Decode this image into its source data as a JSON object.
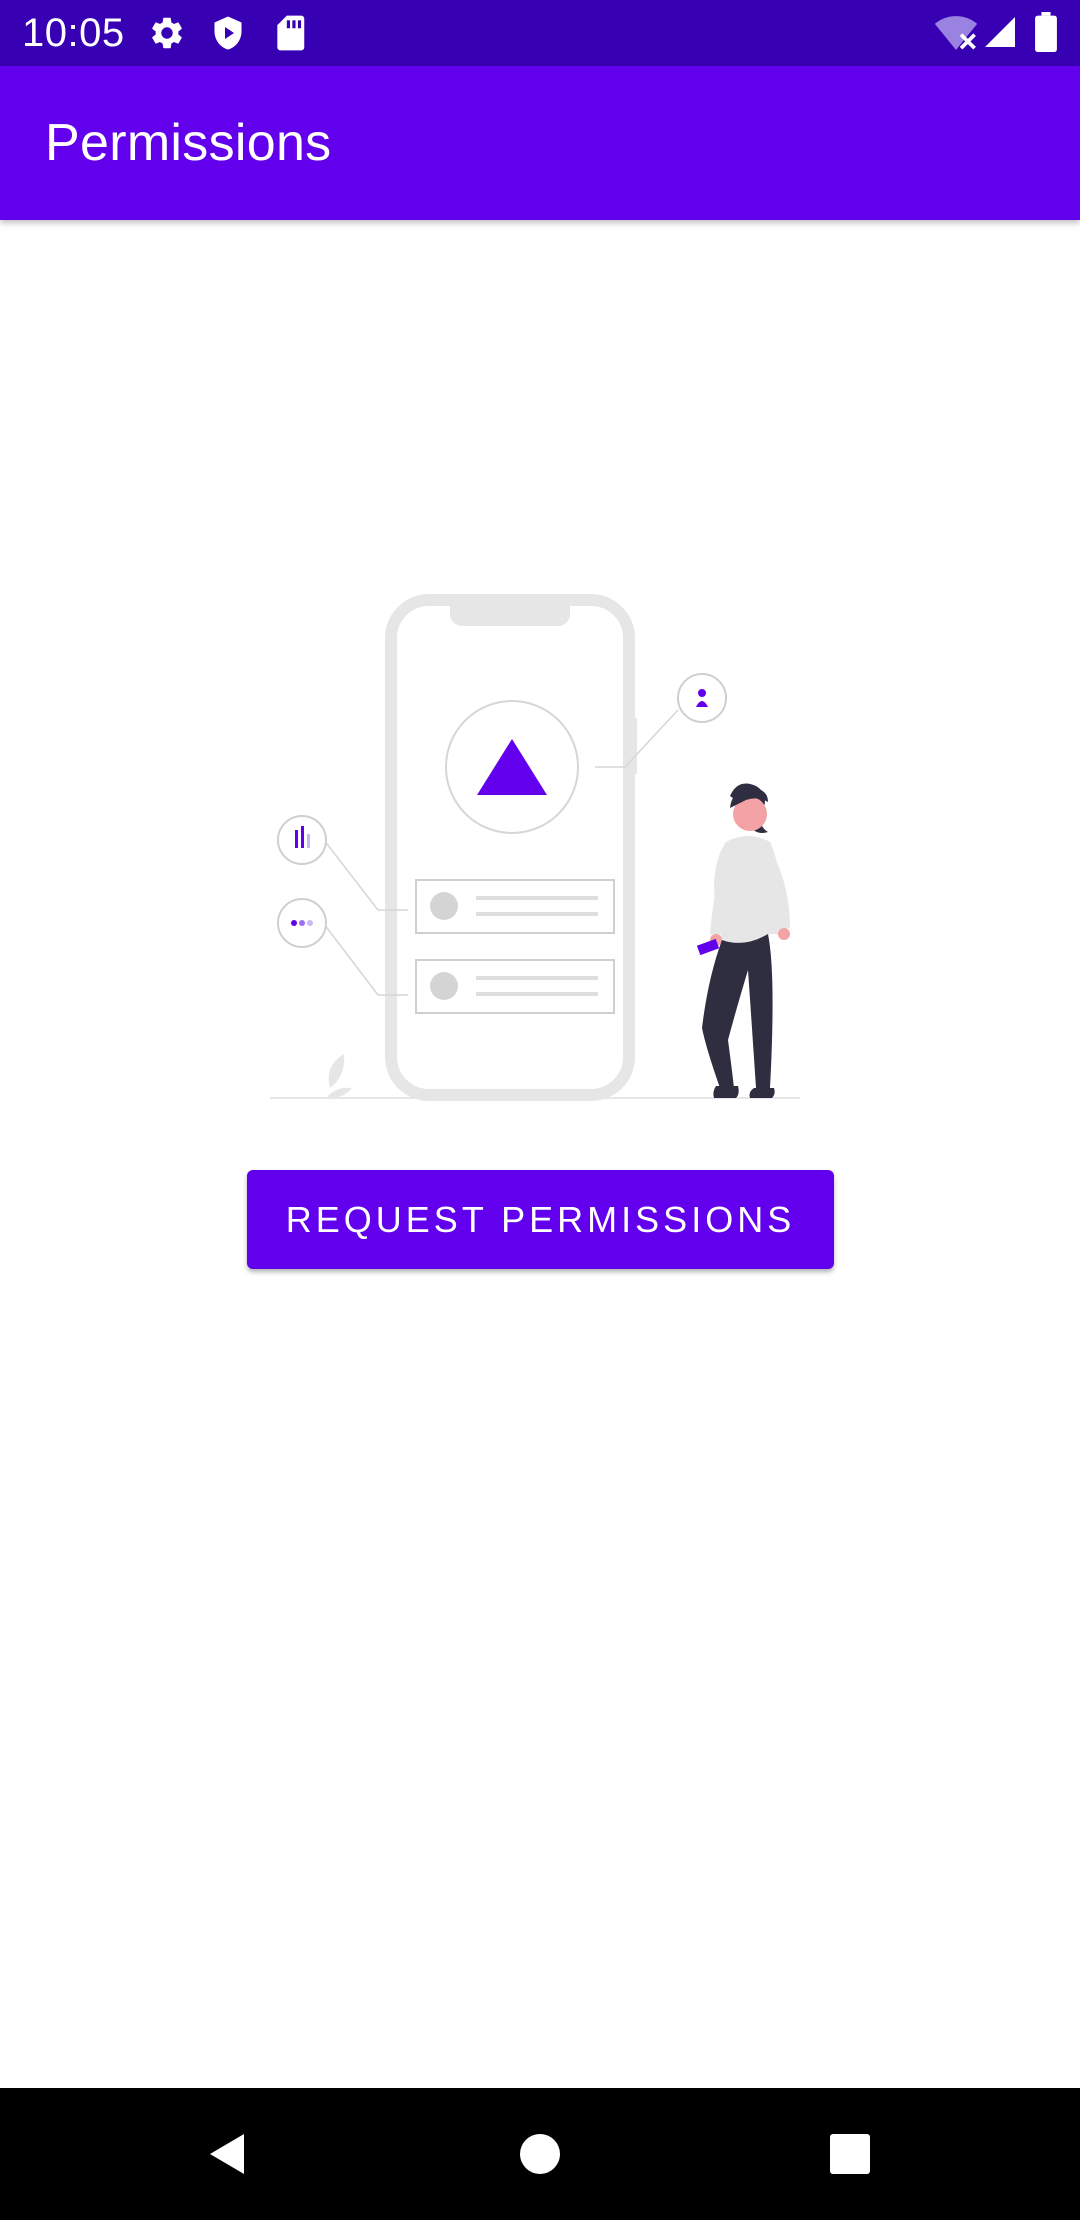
{
  "status_bar": {
    "time": "10:05",
    "left_icons": [
      "gear-icon",
      "shield-play-icon",
      "sd-card-icon"
    ],
    "right_icons": [
      "wifi-off-icon",
      "cell-signal-icon",
      "battery-icon"
    ]
  },
  "app_bar": {
    "title": "Permissions"
  },
  "illustration": {
    "description_icon": "phone-permissions-illustration",
    "accent_color": "#6200ee"
  },
  "main": {
    "request_button_label": "REQUEST PERMISSIONS"
  },
  "nav_bar": {
    "buttons": [
      "back-icon",
      "home-icon",
      "recents-icon"
    ]
  },
  "colors": {
    "status_bar": "#3700b3",
    "primary": "#6200ee",
    "background": "#ffffff",
    "nav_bar": "#000000"
  }
}
